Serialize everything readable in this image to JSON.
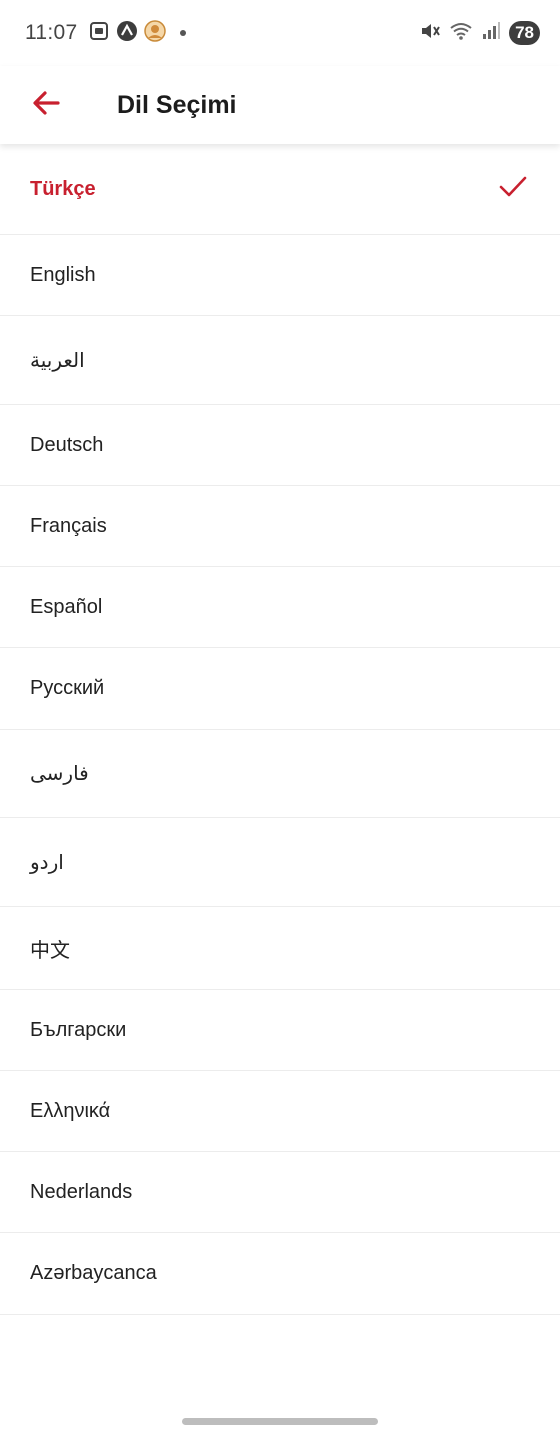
{
  "status_bar": {
    "time": "11:07",
    "battery": "78",
    "icons_left": [
      "screenshot-icon",
      "app-a-icon",
      "avatar-icon",
      "notification-dot"
    ],
    "icons_right": [
      "mute-icon",
      "wifi-icon",
      "signal-icon",
      "battery-icon"
    ]
  },
  "header": {
    "title": "Dil Seçimi",
    "back_icon": "arrow-left-icon"
  },
  "languages": [
    {
      "label": "Türkçe",
      "selected": true
    },
    {
      "label": "English"
    },
    {
      "label": "العربية"
    },
    {
      "label": "Deutsch"
    },
    {
      "label": "Français"
    },
    {
      "label": "Español"
    },
    {
      "label": "Русский"
    },
    {
      "label": "فارسی"
    },
    {
      "label": "اردو"
    },
    {
      "label": "中文"
    },
    {
      "label": "Български"
    },
    {
      "label": "Ελληνικά"
    },
    {
      "label": "Nederlands"
    },
    {
      "label": "Azərbaycanca"
    }
  ],
  "colors": {
    "accent": "#c8202f",
    "text": "#222222",
    "divider": "#ececec",
    "background": "#ffffff"
  }
}
